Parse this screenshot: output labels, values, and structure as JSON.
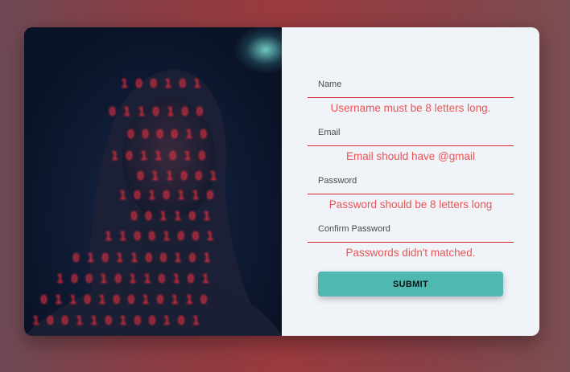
{
  "form": {
    "name_placeholder": "Name",
    "name_error": "Username must be 8 letters long.",
    "email_placeholder": "Email",
    "email_error": "Email should have @gmail",
    "password_placeholder": "Password",
    "password_error": "Password should be 8 letters long",
    "confirm_placeholder": "Confirm Password",
    "confirm_error": "Passwords didn't matched.",
    "submit_label": "SUBMIT"
  },
  "colors": {
    "accent": "#4fb8b0",
    "error": "#e85656",
    "underline": "#d62828",
    "panel": "#f0f3f8"
  }
}
